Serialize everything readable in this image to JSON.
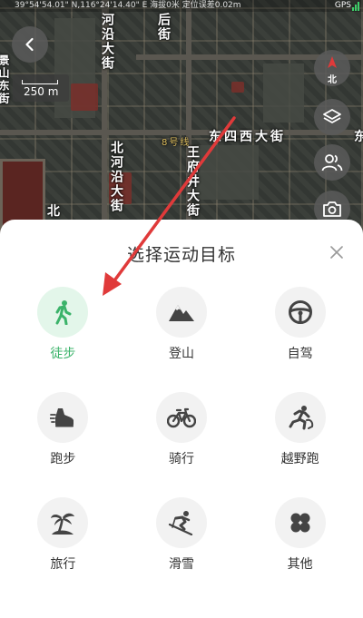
{
  "status_bar": {
    "coordinates": "39°54'54.01\" N,116°24'14.40\" E 海拔0米 定位误差0.02m",
    "gps_label": "GPS"
  },
  "map": {
    "scale_text": "250 m",
    "compass_label": "北",
    "labels": {
      "street_1": "河沿大街",
      "street_2": "后街",
      "street_3": "北河沿大街",
      "street_4": "东四西大街",
      "street_5": "王府井大街",
      "left_edge": "景山东街",
      "bottom_left": "北",
      "right_edge": "东",
      "metro": "8号线"
    }
  },
  "sheet": {
    "title": "选择运动目标",
    "options": [
      {
        "label": "徒步",
        "icon": "walking-icon",
        "selected": true
      },
      {
        "label": "登山",
        "icon": "mountain-icon",
        "selected": false
      },
      {
        "label": "自驾",
        "icon": "steering-wheel-icon",
        "selected": false
      },
      {
        "label": "跑步",
        "icon": "running-shoe-icon",
        "selected": false
      },
      {
        "label": "骑行",
        "icon": "bicycle-icon",
        "selected": false
      },
      {
        "label": "越野跑",
        "icon": "trail-runner-icon",
        "selected": false
      },
      {
        "label": "旅行",
        "icon": "palm-tree-icon",
        "selected": false
      },
      {
        "label": "滑雪",
        "icon": "skier-icon",
        "selected": false
      },
      {
        "label": "其他",
        "icon": "clover-icon",
        "selected": false
      }
    ]
  },
  "colors": {
    "accent_green": "#3bb36a",
    "selected_bg": "#e3f6ea",
    "icon_gray": "#444444",
    "annotation_arrow": "#e03a3a"
  }
}
